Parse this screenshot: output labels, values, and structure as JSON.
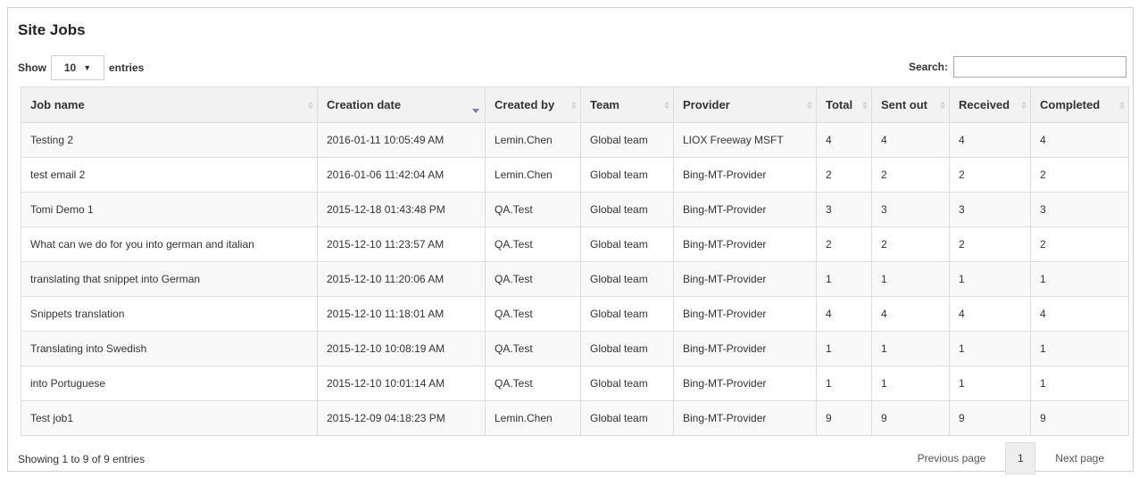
{
  "title": "Site Jobs",
  "length_menu": {
    "show_label": "Show",
    "value": "10",
    "entries_label": "entries"
  },
  "search": {
    "label": "Search:",
    "value": ""
  },
  "table": {
    "columns": [
      {
        "label": "Job name",
        "sort": "none"
      },
      {
        "label": "Creation date",
        "sort": "desc"
      },
      {
        "label": "Created by",
        "sort": "none"
      },
      {
        "label": "Team",
        "sort": "none"
      },
      {
        "label": "Provider",
        "sort": "none"
      },
      {
        "label": "Total",
        "sort": "none"
      },
      {
        "label": "Sent out",
        "sort": "none"
      },
      {
        "label": "Received",
        "sort": "none"
      },
      {
        "label": "Completed",
        "sort": "none"
      }
    ],
    "rows": [
      [
        "Testing 2",
        "2016-01-11 10:05:49 AM",
        "Lemin.Chen",
        "Global team",
        "LIOX Freeway MSFT",
        "4",
        "4",
        "4",
        "4"
      ],
      [
        "test email 2",
        "2016-01-06 11:42:04 AM",
        "Lemin.Chen",
        "Global team",
        "Bing-MT-Provider",
        "2",
        "2",
        "2",
        "2"
      ],
      [
        "Tomi Demo 1",
        "2015-12-18 01:43:48 PM",
        "QA.Test",
        "Global team",
        "Bing-MT-Provider",
        "3",
        "3",
        "3",
        "3"
      ],
      [
        "What can we do for you into german and italian",
        "2015-12-10 11:23:57 AM",
        "QA.Test",
        "Global team",
        "Bing-MT-Provider",
        "2",
        "2",
        "2",
        "2"
      ],
      [
        "translating that snippet into German",
        "2015-12-10 11:20:06 AM",
        "QA.Test",
        "Global team",
        "Bing-MT-Provider",
        "1",
        "1",
        "1",
        "1"
      ],
      [
        "Snippets translation",
        "2015-12-10 11:18:01 AM",
        "QA.Test",
        "Global team",
        "Bing-MT-Provider",
        "4",
        "4",
        "4",
        "4"
      ],
      [
        "Translating into Swedish",
        "2015-12-10 10:08:19 AM",
        "QA.Test",
        "Global team",
        "Bing-MT-Provider",
        "1",
        "1",
        "1",
        "1"
      ],
      [
        "into Portuguese",
        "2015-12-10 10:01:14 AM",
        "QA.Test",
        "Global team",
        "Bing-MT-Provider",
        "1",
        "1",
        "1",
        "1"
      ],
      [
        "Test job1",
        "2015-12-09 04:18:23 PM",
        "Lemin.Chen",
        "Global team",
        "Bing-MT-Provider",
        "9",
        "9",
        "9",
        "9"
      ]
    ]
  },
  "info": "Showing 1 to 9 of 9 entries",
  "pagination": {
    "previous_label": "Previous page",
    "current_page": "1",
    "next_label": "Next page"
  },
  "icons": {
    "sort": "sort-both-icon",
    "sort_active": "sort-desc-icon",
    "dropdown": "caret-down-icon"
  },
  "colors": {
    "sort_active": "#6a7fc9",
    "header_bg": "#f2f2f2",
    "row_alt_bg": "#f9f9f9",
    "border": "#dddddd"
  }
}
